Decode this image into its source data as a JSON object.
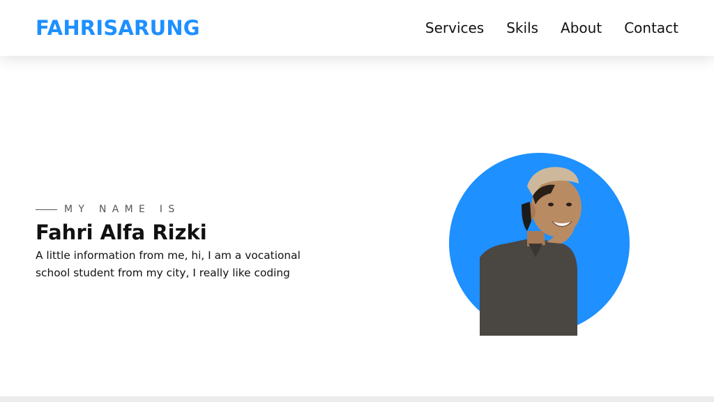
{
  "colors": {
    "brand": "#1e90ff",
    "text": "#111111",
    "muted": "#555555",
    "background": "#ffffff"
  },
  "header": {
    "logo": "FAHRISARUNG",
    "nav": [
      {
        "label": "Services"
      },
      {
        "label": "Skils"
      },
      {
        "label": "About"
      },
      {
        "label": "Contact"
      }
    ]
  },
  "hero": {
    "eyebrow": "MY NAME IS",
    "name": "Fahri Alfa Rizki",
    "description": "A little information from me, hi, I am a vocational school student from my city, I really like coding",
    "photo_icon": "profile-photo"
  }
}
